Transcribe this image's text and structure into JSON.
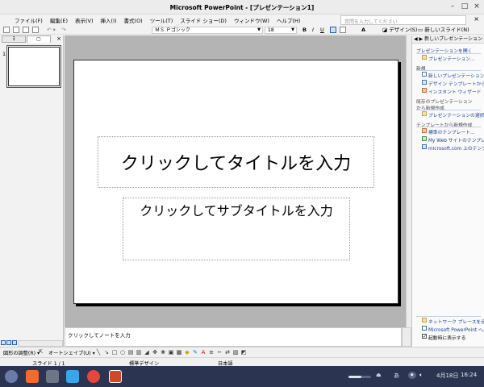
{
  "window": {
    "title": "Microsoft PowerPoint - [プレゼンテーション1]",
    "min": "–",
    "max": "□",
    "close": "×"
  },
  "menubar": {
    "items": [
      "ファイル(F)",
      "編集(E)",
      "表示(V)",
      "挿入(I)",
      "書式(O)",
      "ツール(T)",
      "スライド ショー(D)",
      "ウィンドウ(W)",
      "ヘルプ(H)"
    ],
    "help_placeholder": "質問を入力してください",
    "close": "×"
  },
  "toolbar": {
    "font": "ＭＳ Ｐゴシック",
    "size": "18",
    "bold": "B",
    "italic": "I",
    "underline": "U",
    "font_color": "A",
    "design": "デザイン(S)",
    "new_slide": "新しいスライド(N)"
  },
  "left_pane": {
    "tab_outline": "ﾖ",
    "tab_slides": "▢",
    "close": "×",
    "slide_number": "1"
  },
  "slide": {
    "title_placeholder": "クリックしてタイトルを入力",
    "subtitle_placeholder": "クリックしてサブタイトルを入力"
  },
  "notes": {
    "placeholder": "クリックしてノートを入力"
  },
  "task_pane": {
    "header": "新しいプレゼンテーション",
    "open_section": "プレゼンテーションを開く",
    "open_item": "プレゼンテーション...",
    "new_section": "新規",
    "new_items": [
      "新しいプレゼンテーション",
      "デザイン テンプレートから",
      "インスタント ウィザード"
    ],
    "existing_section_1": "既存のプレゼンテーション",
    "existing_section_2": "から新規作成",
    "existing_item": "プレゼンテーションの選択",
    "template_section": "テンプレートから新規作成",
    "template_items": [
      "標準のテンプレート...",
      "My Web サイトのテンプレート",
      "microsoft.com 上のテンプレート"
    ],
    "bottom_items": [
      "ネットワーク プレースを追加",
      "Microsoft PowerPoint ヘルプ"
    ],
    "show_on_startup": "起動時に表示する",
    "show_on_startup_checked": true
  },
  "drawbar": {
    "figure_adjust": "図形の調整(R)",
    "autoshape": "オートシェイプ(U)"
  },
  "statusbar": {
    "slide": "スライド 1 / 1",
    "design": "標準デザイン",
    "language": "日本語"
  },
  "shelf": {
    "ime": "あ",
    "date": "4月18日",
    "time": "16:24"
  }
}
